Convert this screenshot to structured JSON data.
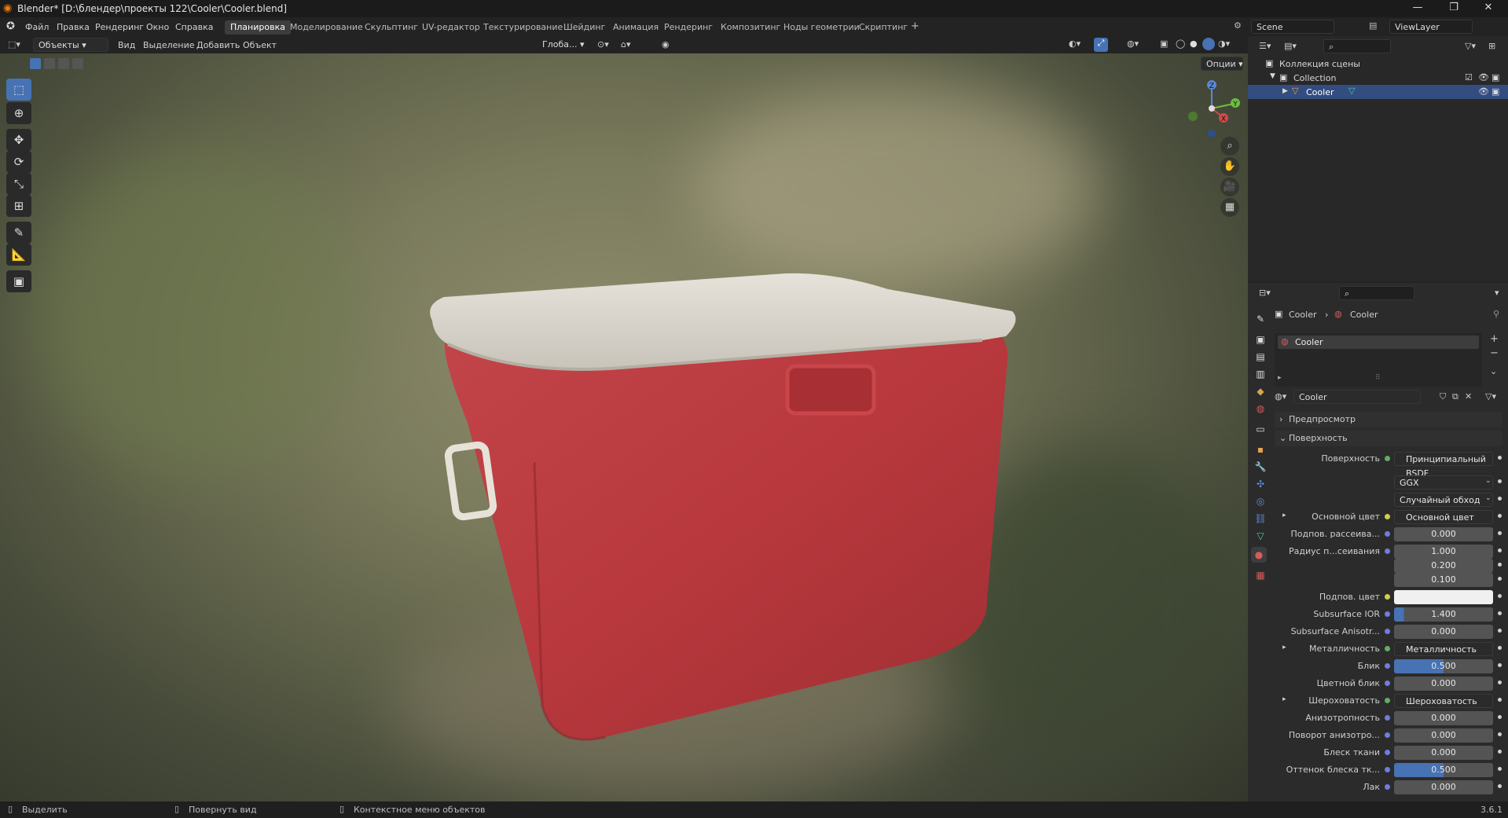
{
  "window": {
    "title": "Blender* [D:\\блендер\\проекты 122\\Cooler\\Cooler.blend]",
    "minimize": "—",
    "maximize": "❐",
    "close": "✕"
  },
  "menu": [
    "Файл",
    "Правка",
    "Рендеринг",
    "Окно",
    "Справка"
  ],
  "workspaces": [
    "Планировка",
    "Моделирование",
    "Скульптинг",
    "UV-редактор",
    "Текстурирование",
    "Шейдинг",
    "Анимация",
    "Рендеринг",
    "Композитинг",
    "Ноды геометрии",
    "Скриптинг"
  ],
  "workspace_add": "+",
  "scene": {
    "name": "Scene",
    "view_layer": "ViewLayer"
  },
  "viewport_header": {
    "mode": "Объекты",
    "items": [
      "Вид",
      "Выделение",
      "Добавить",
      "Объект"
    ],
    "orientation": "Глоба...",
    "options": "Опции"
  },
  "gizmo": {
    "x": "X",
    "y": "Y",
    "z": "Z"
  },
  "outliner": {
    "root": "Коллекция сцены",
    "collection": "Collection",
    "object": "Cooler"
  },
  "properties": {
    "breadcrumb": [
      "Cooler",
      "Cooler"
    ],
    "material_slot": "Cooler",
    "material_name": "Cooler",
    "panels": {
      "preview": "Предпросмотр",
      "surface": "Поверхность"
    },
    "rows": [
      {
        "label": "Поверхность",
        "value": "Принципиальный BSDF",
        "kind": "link",
        "dot": "green"
      },
      {
        "label": "",
        "value": "GGX",
        "kind": "dd"
      },
      {
        "label": "",
        "value": "Случайный обход",
        "kind": "dd"
      },
      {
        "label": "Основной цвет",
        "value": "Основной цвет",
        "kind": "link",
        "dot": "yellow",
        "expand": true
      },
      {
        "label": "Подпов. рассеива...",
        "value": "0.000",
        "kind": "num",
        "dot": "blue"
      },
      {
        "label": "Радиус п...сеивания",
        "value": "1.000",
        "kind": "num",
        "dot": "blue"
      },
      {
        "label": "",
        "value": "0.200",
        "kind": "num"
      },
      {
        "label": "",
        "value": "0.100",
        "kind": "num"
      },
      {
        "label": "Подпов. цвет",
        "value": "",
        "kind": "color",
        "dot": "yellow"
      },
      {
        "label": "Subsurface IOR",
        "value": "1.400",
        "kind": "num",
        "dot": "blue",
        "fill": 0.1
      },
      {
        "label": "Subsurface Anisotr...",
        "value": "0.000",
        "kind": "num",
        "dot": "blue"
      },
      {
        "label": "Металличность",
        "value": "Металличность",
        "kind": "link",
        "dot": "green",
        "expand": true
      },
      {
        "label": "Блик",
        "value": "0.500",
        "kind": "num",
        "dot": "blue",
        "fill": 0.5
      },
      {
        "label": "Цветной блик",
        "value": "0.000",
        "kind": "num",
        "dot": "blue"
      },
      {
        "label": "Шероховатость",
        "value": "Шероховатость",
        "kind": "link",
        "dot": "green",
        "expand": true
      },
      {
        "label": "Анизотропность",
        "value": "0.000",
        "kind": "num",
        "dot": "blue"
      },
      {
        "label": "Поворот анизотро...",
        "value": "0.000",
        "kind": "num",
        "dot": "blue"
      },
      {
        "label": "Блеск ткани",
        "value": "0.000",
        "kind": "num",
        "dot": "blue"
      },
      {
        "label": "Оттенок блеска тк...",
        "value": "0.500",
        "kind": "num",
        "dot": "blue",
        "fill": 0.5
      },
      {
        "label": "Лак",
        "value": "0.000",
        "kind": "num",
        "dot": "blue"
      }
    ]
  },
  "statusbar": {
    "select": "Выделить",
    "rotate": "Повернуть вид",
    "context": "Контекстное меню объектов",
    "version": "3.6.1"
  },
  "colors": {
    "accent": "#4772b3",
    "cooler_body": "#b8383d",
    "lid": "#d8d4cc"
  }
}
